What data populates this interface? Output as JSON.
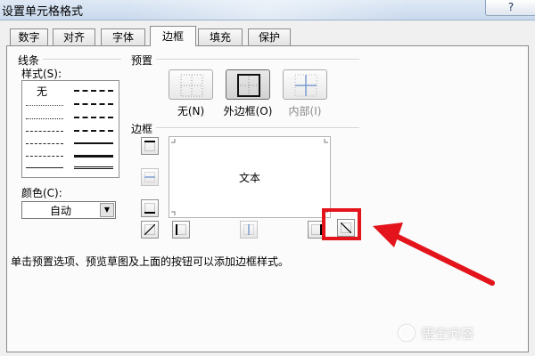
{
  "window": {
    "title": "设置单元格格式",
    "help_button": "?"
  },
  "tabs": [
    {
      "label": "数字",
      "active": false
    },
    {
      "label": "对齐",
      "active": false
    },
    {
      "label": "字体",
      "active": false
    },
    {
      "label": "边框",
      "active": true
    },
    {
      "label": "填充",
      "active": false
    },
    {
      "label": "保护",
      "active": false
    }
  ],
  "line": {
    "section_label": "线条",
    "style_label": "样式(S):",
    "none_label": "无",
    "color_label": "颜色(C):",
    "color_value": "自动"
  },
  "presets": {
    "section_label": "预置",
    "items": [
      {
        "label": "无(N)",
        "icon": "preset-none-icon"
      },
      {
        "label": "外边框(O)",
        "icon": "preset-outline-icon",
        "pressed": true
      },
      {
        "label": "内部(I)",
        "icon": "preset-inside-icon",
        "disabled": true
      }
    ]
  },
  "border": {
    "section_label": "边框",
    "preview_text": "文本"
  },
  "hint_text": "单击预置选项、预览草图及上面的按钮可以添加边框样式。",
  "watermark": "悟空问答",
  "colors": {
    "annotation": "#e3141b",
    "panel": "#fbfbfb",
    "titlebar": "#c9d9ed"
  }
}
